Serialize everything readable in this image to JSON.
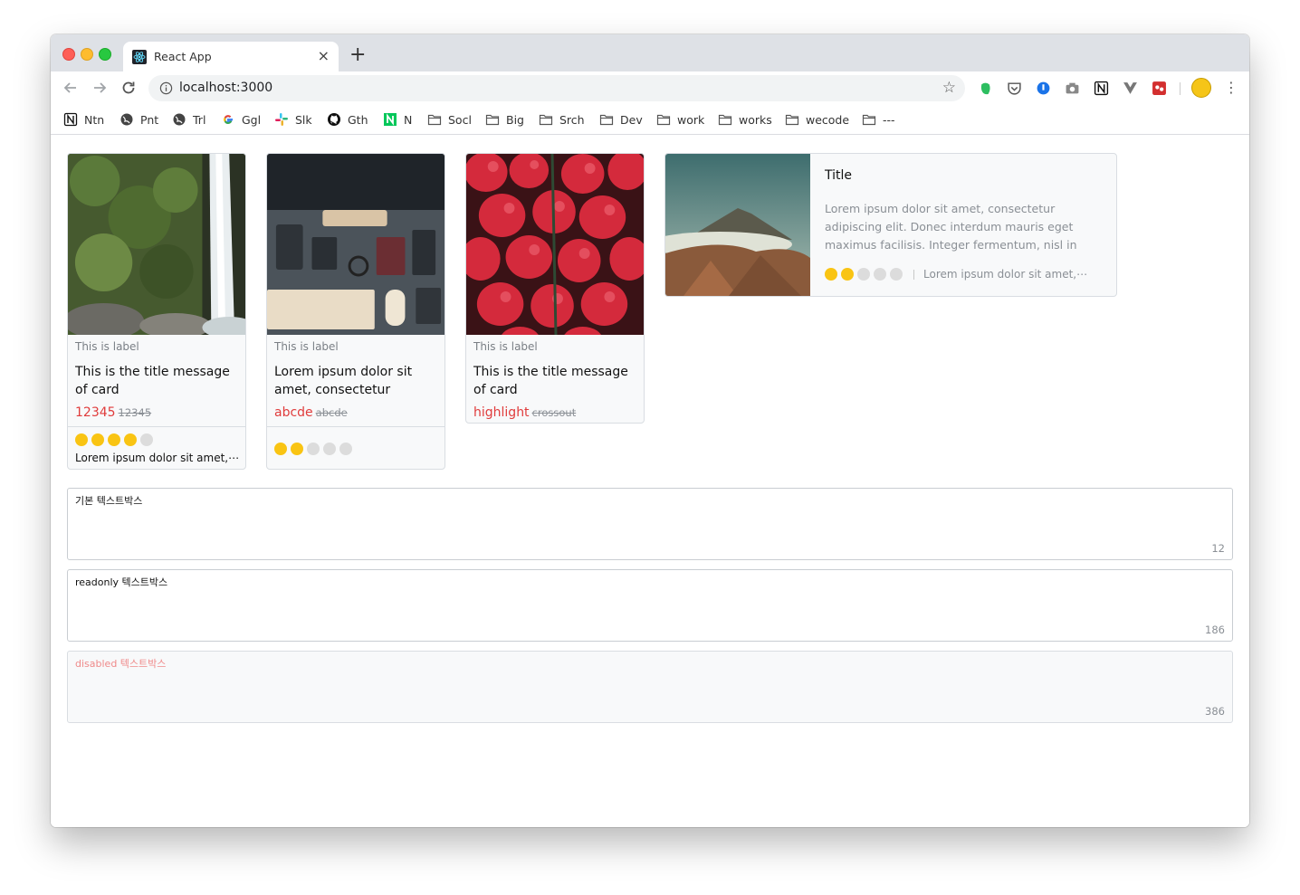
{
  "browser": {
    "tab_title": "React App",
    "tab_close": "×",
    "new_tab": "+",
    "url": "localhost:3000",
    "bookmarks": [
      {
        "label": "Ntn",
        "icon": "notion-icon"
      },
      {
        "label": "Pnt",
        "icon": "globe-icon"
      },
      {
        "label": "Trl",
        "icon": "globe-icon"
      },
      {
        "label": "Ggl",
        "icon": "google-icon"
      },
      {
        "label": "Slk",
        "icon": "slack-icon"
      },
      {
        "label": "Gth",
        "icon": "github-icon"
      },
      {
        "label": "N",
        "icon": "naver-icon"
      },
      {
        "label": "Socl",
        "icon": "folder-icon"
      },
      {
        "label": "Big",
        "icon": "folder-icon"
      },
      {
        "label": "Srch",
        "icon": "folder-icon"
      },
      {
        "label": "Dev",
        "icon": "folder-icon"
      },
      {
        "label": "work",
        "icon": "folder-icon"
      },
      {
        "label": "works",
        "icon": "folder-icon"
      },
      {
        "label": "wecode",
        "icon": "folder-icon"
      },
      {
        "label": "---",
        "icon": "folder-icon"
      }
    ]
  },
  "cards": [
    {
      "label": "This is label",
      "title": "This is the title message of card",
      "price": "12345",
      "price_strike": "12345",
      "rating": 4,
      "description": "Lorem ipsum dolor sit amet,⋯",
      "image": "waterfall"
    },
    {
      "label": "This is label",
      "title": "Lorem ipsum dolor sit amet, consectetur adipiscing elit.⋯",
      "price": "abcde",
      "price_strike": "abcde",
      "rating": 2,
      "image": "desk"
    },
    {
      "label": "This is label",
      "title": "This is the title message of card",
      "price": "highlight",
      "price_strike": "crossout",
      "image": "strawberries"
    }
  ],
  "horizontal_card": {
    "title": "Title",
    "body": "Lorem ipsum dolor sit amet, consectetur adipiscing elit. Donec interdum mauris eget maximus facilisis. Integer fermentum, nisl in finibus pharetra, est⋯",
    "rating": 2,
    "description": "Lorem ipsum dolor sit amet,⋯",
    "image": "mountain"
  },
  "textboxes": [
    {
      "text": "기본 텍스트박스",
      "count": "12",
      "state": "default"
    },
    {
      "text": "readonly 텍스트박스",
      "count": "186",
      "state": "readonly"
    },
    {
      "text": "disabled 텍스트박스",
      "count": "386",
      "state": "disabled"
    }
  ],
  "colors": {
    "accent_red": "#e03c3c",
    "star_on": "#f9c413",
    "star_off": "#dcdcdc"
  }
}
